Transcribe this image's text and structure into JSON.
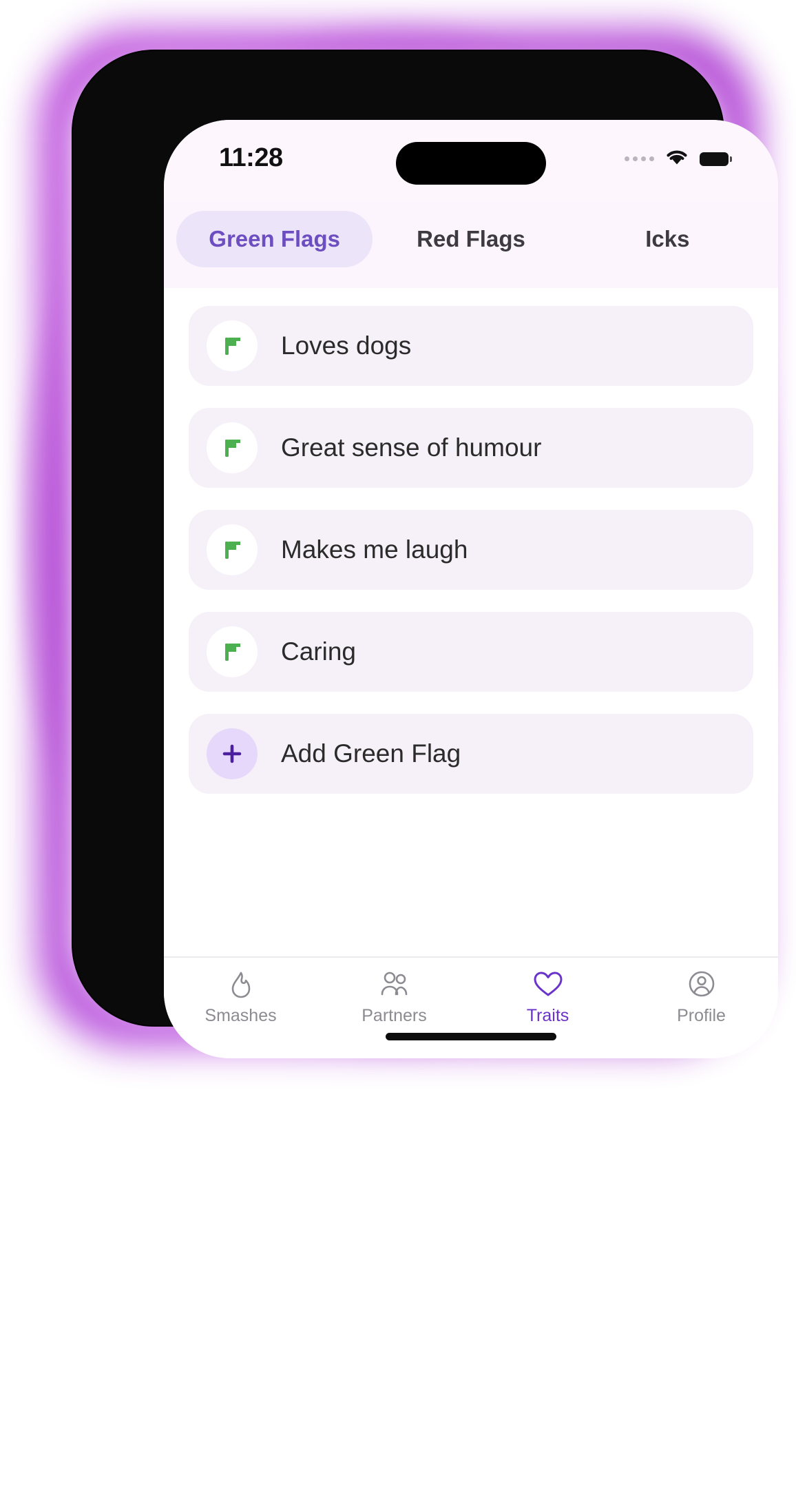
{
  "colors": {
    "accent_purple": "#6c4ec0",
    "nav_active": "#6a33c9",
    "flag_green": "#4caf50",
    "row_bg": "#f6f0f8",
    "tab_bg": "#fdf5fd",
    "active_tab_pill": "#ece4f8",
    "glow": "#b44ad6"
  },
  "statusbar": {
    "time": "11:28",
    "cellular_icon": "cellular-dots-icon",
    "wifi_icon": "wifi-icon",
    "battery_icon": "battery-full-icon"
  },
  "tabs": [
    {
      "label": "Green Flags",
      "active": true
    },
    {
      "label": "Red Flags",
      "active": false
    },
    {
      "label": "Icks",
      "active": false
    }
  ],
  "list": {
    "items": [
      {
        "label": "Loves dogs",
        "icon": "green-flag-icon",
        "type": "trait"
      },
      {
        "label": "Great sense of humour",
        "icon": "green-flag-icon",
        "type": "trait"
      },
      {
        "label": "Makes me laugh",
        "icon": "green-flag-icon",
        "type": "trait"
      },
      {
        "label": "Caring",
        "icon": "green-flag-icon",
        "type": "trait"
      },
      {
        "label": "Add Green Flag",
        "icon": "plus-icon",
        "type": "add"
      }
    ]
  },
  "bottomnav": {
    "items": [
      {
        "label": "Smashes",
        "icon": "flame-icon",
        "active": false
      },
      {
        "label": "Partners",
        "icon": "people-icon",
        "active": false
      },
      {
        "label": "Traits",
        "icon": "heart-icon",
        "active": true
      },
      {
        "label": "Profile",
        "icon": "person-circle-icon",
        "active": false
      }
    ]
  }
}
